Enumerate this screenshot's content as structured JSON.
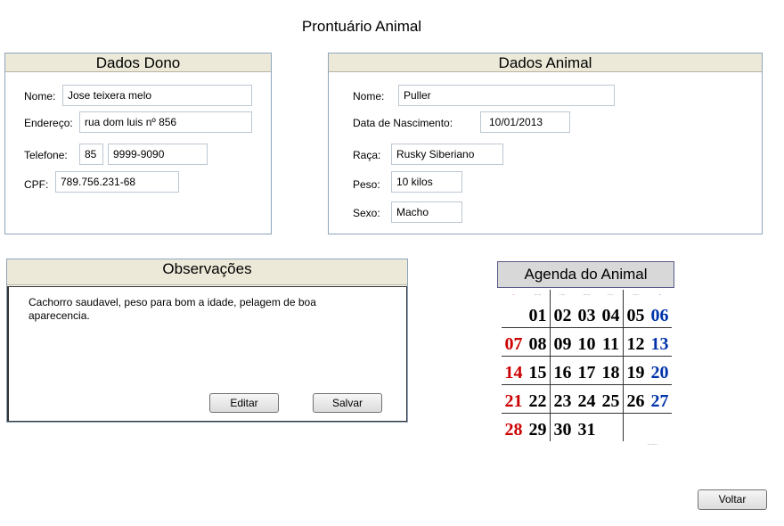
{
  "title": "Prontuário Animal",
  "owner": {
    "heading": "Dados Dono",
    "name_label": "Nome:",
    "name_value": "Jose teixera melo",
    "address_label": "Endereço:",
    "address_value": "rua dom luis nº 856",
    "phone_label": "Telefone:",
    "phone_ddd": "85",
    "phone_number": "9999-9090",
    "cpf_label": "CPF:",
    "cpf_value": "789.756.231-68"
  },
  "animal": {
    "heading": "Dados Animal",
    "name_label": "Nome:",
    "name_value": "Puller",
    "birth_label": "Data de Nascimento:",
    "birth_value": "10/01/2013",
    "breed_label": "Raça:",
    "breed_value": "Rusky Siberiano",
    "weight_label": "Peso:",
    "weight_value": "10 kilos",
    "sex_label": "Sexo:",
    "sex_value": "Macho"
  },
  "observations": {
    "heading": "Observações",
    "text": "Cachorro saudavel, peso para bom a idade, pelagem de boa aparecencia.",
    "edit_label": "Editar",
    "save_label": "Salvar"
  },
  "agenda": {
    "heading": "Agenda do Animal",
    "weeks": [
      [
        "",
        "01",
        "02",
        "03",
        "04",
        "05",
        "06"
      ],
      [
        "07",
        "08",
        "09",
        "10",
        "11",
        "12",
        "13"
      ],
      [
        "14",
        "15",
        "16",
        "17",
        "18",
        "19",
        "20"
      ],
      [
        "21",
        "22",
        "23",
        "24",
        "25",
        "26",
        "27"
      ],
      [
        "28",
        "29",
        "30",
        "31",
        "",
        "",
        ""
      ]
    ],
    "colors": {
      "sunday": "#cc0000",
      "saturday": "#0033aa"
    }
  },
  "back_label": "Voltar"
}
